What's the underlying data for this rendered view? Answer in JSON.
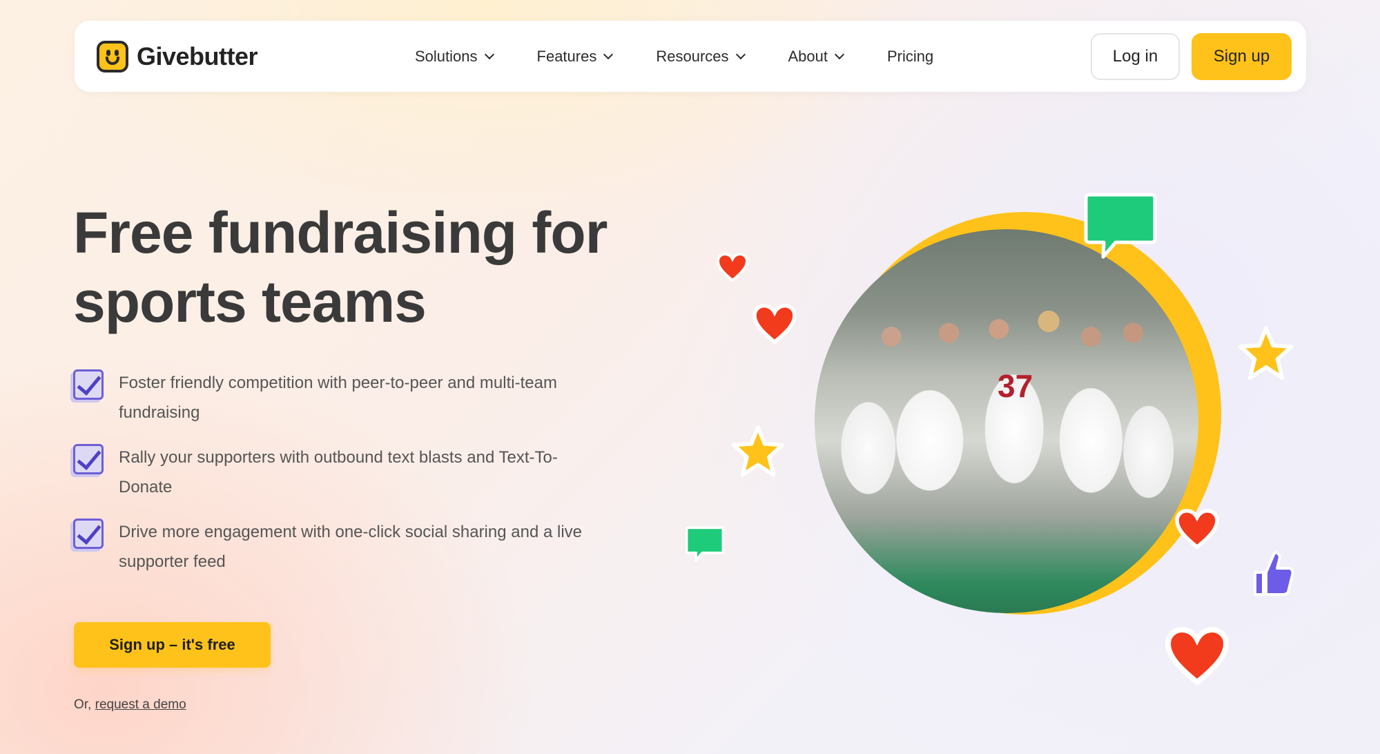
{
  "brand": {
    "name": "Givebutter",
    "accent": "#ffc21a",
    "check_color": "#6d5fd6"
  },
  "nav": {
    "items": [
      {
        "label": "Solutions",
        "has_dropdown": true
      },
      {
        "label": "Features",
        "has_dropdown": true
      },
      {
        "label": "Resources",
        "has_dropdown": true
      },
      {
        "label": "About",
        "has_dropdown": true
      },
      {
        "label": "Pricing",
        "has_dropdown": false
      }
    ],
    "login_label": "Log in",
    "signup_label": "Sign up"
  },
  "hero": {
    "title": "Free fundraising for sports teams",
    "features": [
      "Foster friendly competition with peer-to-peer and multi-team fundraising",
      "Rally your supporters with outbound text blasts and Text-To-Donate",
      "Drive more engagement with one-click social sharing and a live supporter feed"
    ],
    "cta_label": "Sign up – it's free",
    "demo_prefix": "Or,",
    "demo_link": "request a demo",
    "photo_jersey": "37"
  },
  "decorations": {
    "icons": [
      "heart-icon",
      "star-icon",
      "chat-bubble-icon",
      "thumbs-up-icon"
    ],
    "colors": {
      "heart": "#f23a1d",
      "star": "#ffc21a",
      "bubble": "#1ecb7b",
      "thumb": "#6c5ce7"
    }
  }
}
